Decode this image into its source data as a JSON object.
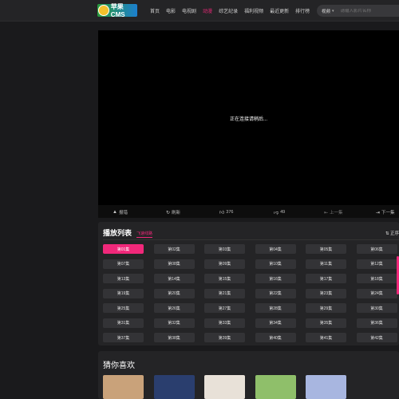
{
  "header": {
    "logo_text": "苹果CMS",
    "nav": [
      "首页",
      "电影",
      "电视剧",
      "动漫",
      "综艺纪录",
      "福利视频",
      "最近更新",
      "排行榜"
    ],
    "active_index": 3,
    "search": {
      "select_label": "视频",
      "placeholder": "请输入影片名称"
    }
  },
  "player": {
    "status_text": "正在连接请稍后...",
    "controls": {
      "report": "报错",
      "refresh": "刷新",
      "likes": "376",
      "dislikes": "49",
      "prev": "上一集",
      "next": "下一集"
    }
  },
  "playlist": {
    "title": "播放列表",
    "source_tab": "飞速线路",
    "sort_label": "正序",
    "episodes": [
      "第01集",
      "第02集",
      "第03集",
      "第04集",
      "第05集",
      "第06集",
      "第07集",
      "第08集",
      "第09集",
      "第10集",
      "第11集",
      "第12集",
      "第13集",
      "第14集",
      "第15集",
      "第16集",
      "第17集",
      "第18集",
      "第19集",
      "第20集",
      "第21集",
      "第22集",
      "第23集",
      "第24集",
      "第25集",
      "第26集",
      "第27集",
      "第28集",
      "第29集",
      "第30集",
      "第31集",
      "第32集",
      "第33集",
      "第34集",
      "第35集",
      "第36集",
      "第37集",
      "第38集",
      "第39集",
      "第40集",
      "第41集",
      "第42集"
    ],
    "active_episode": "第01集"
  },
  "recommend": {
    "title": "猜你喜欢",
    "thumb_colors": [
      "#c9a27a",
      "#2a3e6e",
      "#e8e1d8",
      "#8fbf6a",
      "#a8b6e0"
    ]
  }
}
